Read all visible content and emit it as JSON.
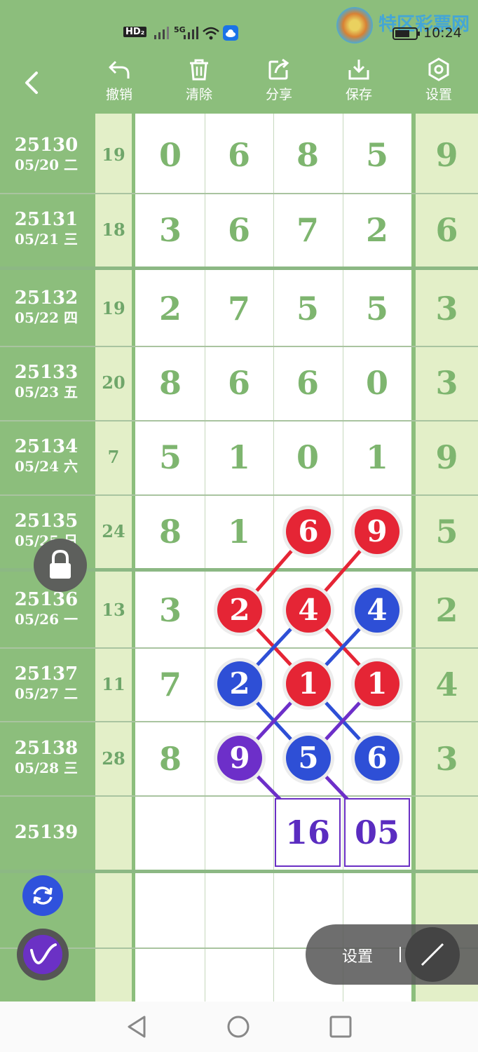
{
  "status_bar": {
    "left_badges": "HD₂",
    "network": "5G",
    "time": "10:24",
    "watermark_text": "特区彩票网"
  },
  "toolbar": {
    "undo": "撤销",
    "clear": "清除",
    "share": "分享",
    "save": "保存",
    "settings": "设置"
  },
  "rows": [
    {
      "issue": "25130",
      "date": "05/20 二",
      "sum": "19",
      "digits": [
        "0",
        "6",
        "8",
        "5"
      ],
      "right": "9"
    },
    {
      "issue": "25131",
      "date": "05/21 三",
      "sum": "18",
      "digits": [
        "3",
        "6",
        "7",
        "2"
      ],
      "right": "6"
    },
    {
      "issue": "25132",
      "date": "05/22 四",
      "sum": "19",
      "digits": [
        "2",
        "7",
        "5",
        "5"
      ],
      "right": "3"
    },
    {
      "issue": "25133",
      "date": "05/23 五",
      "sum": "20",
      "digits": [
        "8",
        "6",
        "6",
        "0"
      ],
      "right": "3"
    },
    {
      "issue": "25134",
      "date": "05/24 六",
      "sum": "7",
      "digits": [
        "5",
        "1",
        "0",
        "1"
      ],
      "right": "9"
    },
    {
      "issue": "25135",
      "date": "05/25 日",
      "sum": "24",
      "digits": [
        "8",
        "1",
        "6",
        "9"
      ],
      "right": "5"
    },
    {
      "issue": "25136",
      "date": "05/26 一",
      "sum": "13",
      "digits": [
        "3",
        "2",
        "4",
        "4"
      ],
      "right": "2"
    },
    {
      "issue": "25137",
      "date": "05/27 二",
      "sum": "11",
      "digits": [
        "7",
        "2",
        "1",
        "1"
      ],
      "right": "4"
    },
    {
      "issue": "25138",
      "date": "05/28 三",
      "sum": "28",
      "digits": [
        "8",
        "9",
        "5",
        "6"
      ],
      "right": "3"
    },
    {
      "issue": "25139",
      "date": "",
      "sum": "",
      "digits": [
        "",
        "",
        "",
        ""
      ],
      "right": ""
    }
  ],
  "highlighted": {
    "red": [
      "6",
      "9",
      "2",
      "4",
      "1",
      "1"
    ],
    "blue": [
      "4",
      "2",
      "5",
      "6"
    ],
    "purple": [
      "9"
    ]
  },
  "results": [
    "16",
    "05"
  ],
  "overlay": {
    "settings_label": "设置"
  },
  "colors": {
    "primary_green": "#8cbe7c",
    "light_green": "#e3efc8",
    "digit_green": "#7eb56f",
    "ball_red": "#e52535",
    "ball_blue": "#2e4fd6",
    "ball_purple": "#6d2fc9"
  }
}
